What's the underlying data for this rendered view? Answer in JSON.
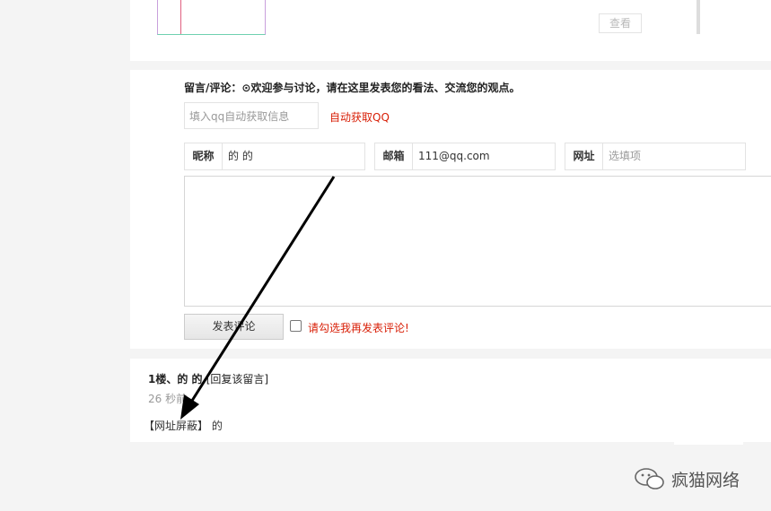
{
  "top": {
    "view_button": "查看"
  },
  "form": {
    "intro": "留言/评论：⊙欢迎参与讨论，请在这里发表您的看法、交流您的观点。",
    "qq_placeholder": "填入qq自动获取信息",
    "qq_link": "自动获取QQ",
    "nickname_label": "昵称",
    "nickname_value": "的 的",
    "email_label": "邮箱",
    "email_value": "111@qq.com",
    "website_label": "网址",
    "website_placeholder": "选填项",
    "submit": "发表评论",
    "checkbox_label": "请勾选我再发表评论!"
  },
  "comment": {
    "floor": "1楼、的 的",
    "reply": "[回复该留言]",
    "time": "26 秒前",
    "masked": "【网址屏蔽】",
    "body": "的"
  },
  "watermark": {
    "text": "疯猫网络"
  }
}
